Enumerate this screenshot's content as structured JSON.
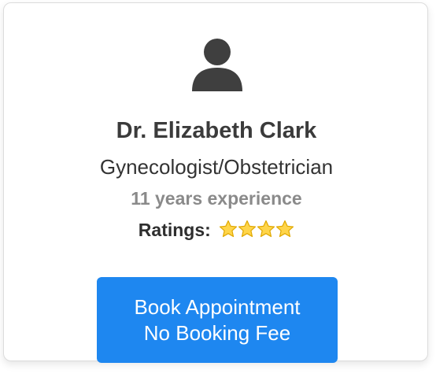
{
  "doctor": {
    "name": "Dr. Elizabeth Clark",
    "specialty": "Gynecologist/Obstetrician",
    "experience": "11 years experience",
    "ratings_label": "Ratings:",
    "rating_stars": 4,
    "avatar_icon": "user-icon",
    "star_icon": "star-icon"
  },
  "booking": {
    "line1": "Book Appointment",
    "line2": "No Booking Fee"
  },
  "colors": {
    "button": "#1e87f0",
    "avatar": "#3f3f3f",
    "star": "#ffd54a"
  }
}
